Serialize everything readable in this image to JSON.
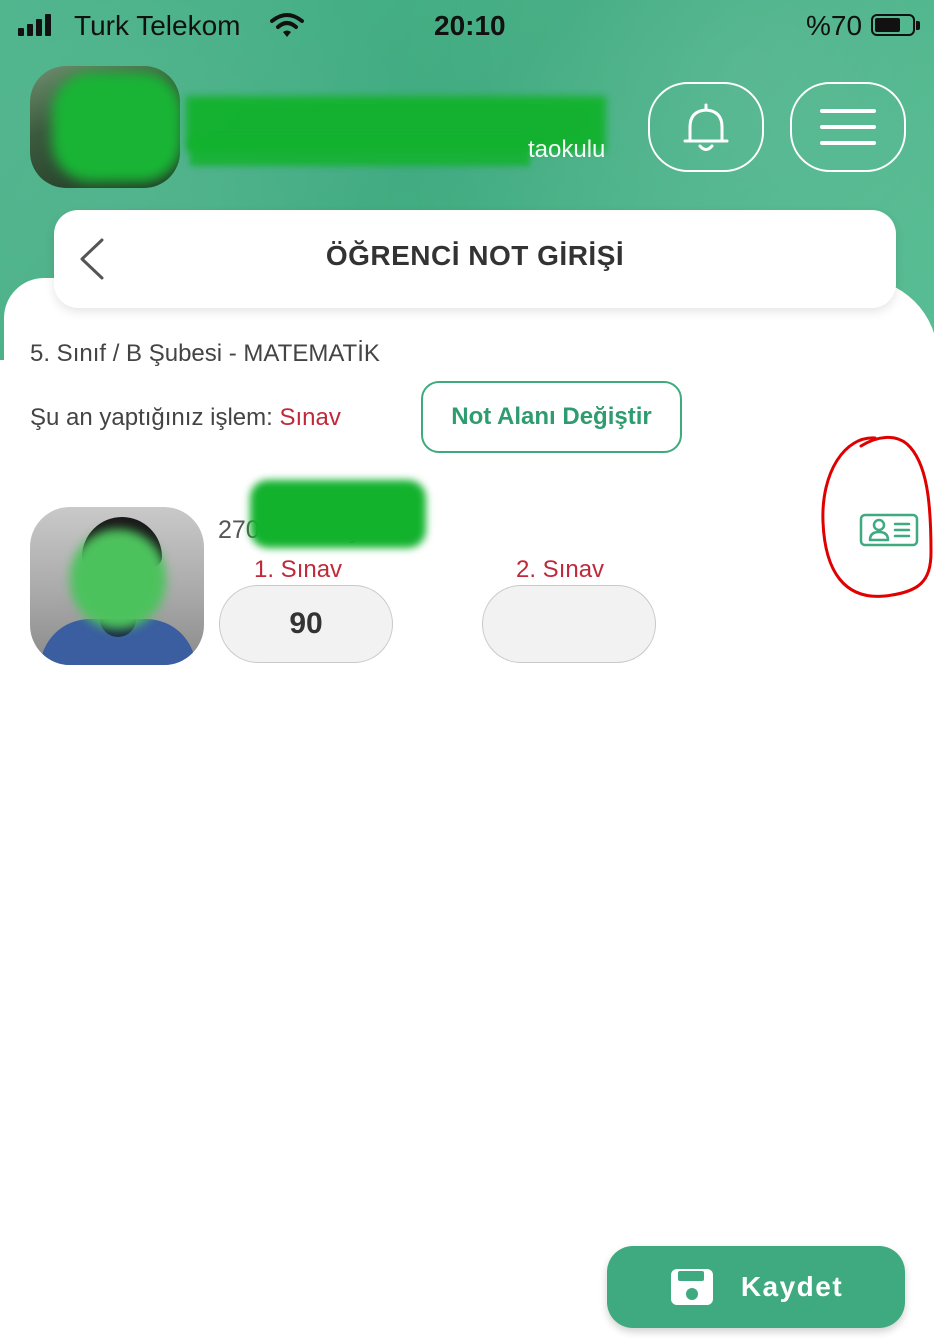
{
  "status_bar": {
    "carrier": "Turk Telekom",
    "time": "20:10",
    "battery_text": "%70",
    "battery_level": 0.7,
    "signal_bars": 4
  },
  "header": {
    "school_name_visible": "taokulu",
    "notification_icon": "bell-icon",
    "menu_icon": "hamburger-menu-icon"
  },
  "title_card": {
    "back_icon": "chevron-left-icon",
    "title": "ÖĞRENCİ NOT GİRİŞİ"
  },
  "class_info": "5. Sınıf / B Şubesi - MATEMATİK",
  "operation": {
    "label": "Şu an yaptığınız işlem:",
    "value": "Sınav",
    "change_button": "Not Alanı Değiştir"
  },
  "students": [
    {
      "number_name": "270 - A                 rmuş",
      "exams": [
        {
          "label": "1. Sınav",
          "score": "90"
        },
        {
          "label": "2. Sınav",
          "score": ""
        }
      ],
      "detail_icon": "id-card-icon"
    }
  ],
  "save_button": {
    "label": "Kaydet",
    "icon": "floppy-disk-icon"
  },
  "colors": {
    "brand_green": "#3faa7f",
    "accent_red": "#c0293a",
    "annotation_red": "#e00000"
  }
}
